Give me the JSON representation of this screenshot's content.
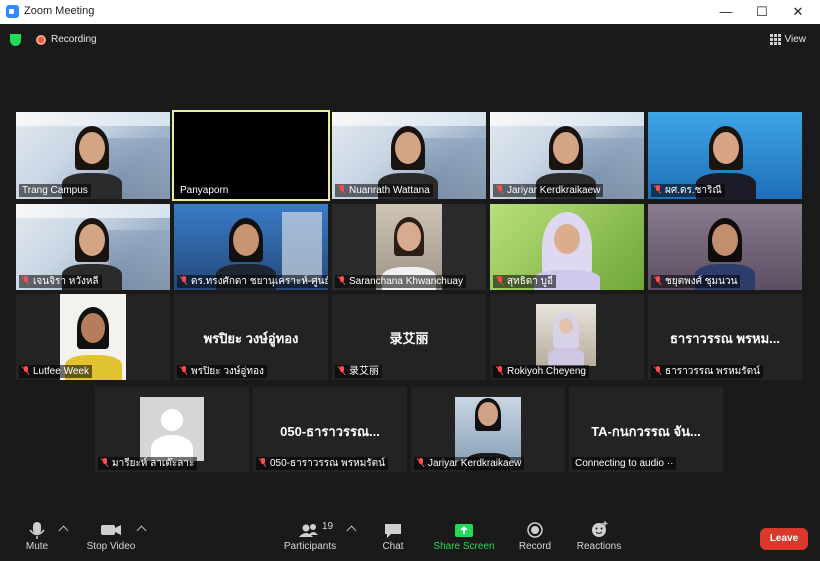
{
  "window": {
    "title": "Zoom Meeting",
    "minimize": "—",
    "maximize": "☐",
    "close": "✕"
  },
  "topbar": {
    "recording_label": "Recording",
    "view_label": "View"
  },
  "participants": [
    {
      "name": "Trang Campus",
      "muted": false,
      "bg": "poster"
    },
    {
      "name": "Panyaporn",
      "muted": false,
      "bg": "black",
      "active": true
    },
    {
      "name": "Nuanrath Wattana",
      "muted": true,
      "bg": "poster"
    },
    {
      "name": "Jariyar Kerdkraikaew",
      "muted": true,
      "bg": "poster"
    },
    {
      "name": "ผศ.ดร.ชาริณี",
      "muted": true,
      "bg": "blue"
    },
    {
      "name": "เจนจิรา หวังหลี",
      "muted": true,
      "bg": "poster"
    },
    {
      "name": "ดร.ทรงศักดา ชยานุเคราะห์-ศูนย์...",
      "muted": true,
      "bg": "office"
    },
    {
      "name": "Saranchana Khwanchuay",
      "muted": true,
      "bg": "room"
    },
    {
      "name": "สุทธิดา บูอี",
      "muted": true,
      "bg": "green"
    },
    {
      "name": "ชยุตพงศ์ ชุมนวน",
      "muted": true,
      "bg": "purple"
    },
    {
      "name": "Lutfee Week",
      "muted": true,
      "bg": "white"
    },
    {
      "name": "พรปิยะ วงษ์อู่ทอง",
      "muted": true,
      "bg": "none",
      "display": "พรปิยะ วงษ์อู่ทอง"
    },
    {
      "name": "录艾丽",
      "muted": true,
      "bg": "none",
      "display": "录艾丽"
    },
    {
      "name": "Rokiyoh Cheyeng",
      "muted": true,
      "bg": "hijab"
    },
    {
      "name": "ธาราวรรณ พรหมรัตน์",
      "muted": true,
      "bg": "none",
      "display": "ธาราวรรณ พรหม..."
    },
    {
      "name": "มารียะห์ ลาเต๊ะลาะ",
      "muted": true,
      "bg": "avatar"
    },
    {
      "name": "050-ธาราวรรณ พรหมรัตน์",
      "muted": true,
      "bg": "none",
      "display": "050-ธาราวรรณ..."
    },
    {
      "name": "Jariyar Kerdkraikaew",
      "muted": true,
      "bg": "desk"
    },
    {
      "name": "Connecting to audio ··",
      "muted": false,
      "bg": "none",
      "display": "TA-กนกวรรณ จัน..."
    }
  ],
  "toolbar": {
    "mute": "Mute",
    "stop_video": "Stop Video",
    "participants": "Participants",
    "participants_count": "19",
    "chat": "Chat",
    "share_screen": "Share Screen",
    "record": "Record",
    "reactions": "Reactions",
    "leave": "Leave"
  },
  "colors": {
    "share_green": "#23d959",
    "leave_red": "#d9392b",
    "muted_red": "#ff4c4c",
    "active_border": "#e6ee9c"
  }
}
